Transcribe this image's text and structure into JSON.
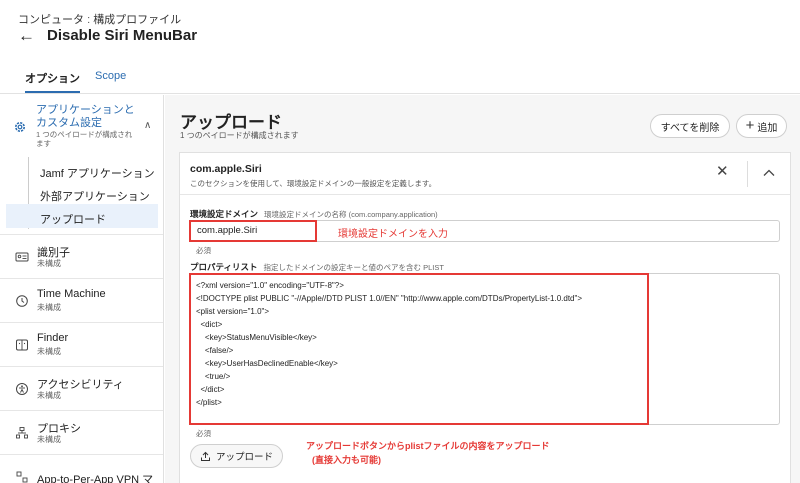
{
  "breadcrumb": {
    "root": "コンピュータ",
    "separator": ":",
    "current": "構成プロファイル"
  },
  "page_title": "Disable Siri MenuBar",
  "tabs": [
    {
      "label": "オプション",
      "active": true
    },
    {
      "label": "Scope",
      "active": false
    }
  ],
  "sidebar": {
    "group": {
      "title": "アプリケーションとカスタム設定",
      "subtitle": "1 つのペイロードが構成されます",
      "items": [
        "Jamf アプリケーション",
        "外部アプリケーション",
        "アップロード"
      ],
      "selected": "アップロード"
    },
    "items": [
      {
        "label": "識別子",
        "status": "未構成",
        "icon": "id-card-icon"
      },
      {
        "label": "Time Machine",
        "status": "未構成",
        "icon": "time-machine-icon"
      },
      {
        "label": "Finder",
        "status": "未構成",
        "icon": "finder-icon"
      },
      {
        "label": "アクセシビリティ",
        "status": "未構成",
        "icon": "accessibility-icon"
      },
      {
        "label": "プロキシ",
        "status": "未構成",
        "icon": "proxy-icon"
      },
      {
        "label": "App-to-Per-App VPN マッピング",
        "status": "",
        "icon": "vpn-icon"
      }
    ]
  },
  "main": {
    "title": "アップロード",
    "subtitle": "1 つのペイロードが構成されます",
    "delete_all": "すべてを削除",
    "add": "追加"
  },
  "payload": {
    "title": "com.apple.Siri",
    "description": "このセクションを使用して、環境設定ドメインの一般設定を定義します。",
    "domain_label": "環境設定ドメイン",
    "domain_hint": "環境設定ドメインの名称 (com.company.application)",
    "domain_value": "com.apple.Siri",
    "domain_required": "必須",
    "plist_label": "プロパティリスト",
    "plist_hint": "指定したドメインの設定キーと値のペアを含む PLIST",
    "plist_lines": [
      "<?xml version=\"1.0\" encoding=\"UTF-8\"?>",
      "<!DOCTYPE plist PUBLIC \"-//Apple//DTD PLIST 1.0//EN\" \"http://www.apple.com/DTDs/PropertyList-1.0.dtd\">",
      "<plist version=\"1.0\">",
      "  <dict>",
      "    <key>StatusMenuVisible</key>",
      "    <false/>",
      "    <key>UserHasDeclinedEnable</key>",
      "    <true/>",
      "  </dict>",
      "</plist>"
    ],
    "plist_required": "必須",
    "upload_button": "アップロード"
  },
  "annotations": {
    "domain": "環境設定ドメインを入力",
    "upload_line1": "アップロードボタンからplistファイルの内容をアップロード",
    "upload_line2": "(直接入力も可能)"
  },
  "colors": {
    "accent": "#2b6cb0",
    "annotation": "#e53935",
    "selected_bg": "#e9f1fb"
  }
}
